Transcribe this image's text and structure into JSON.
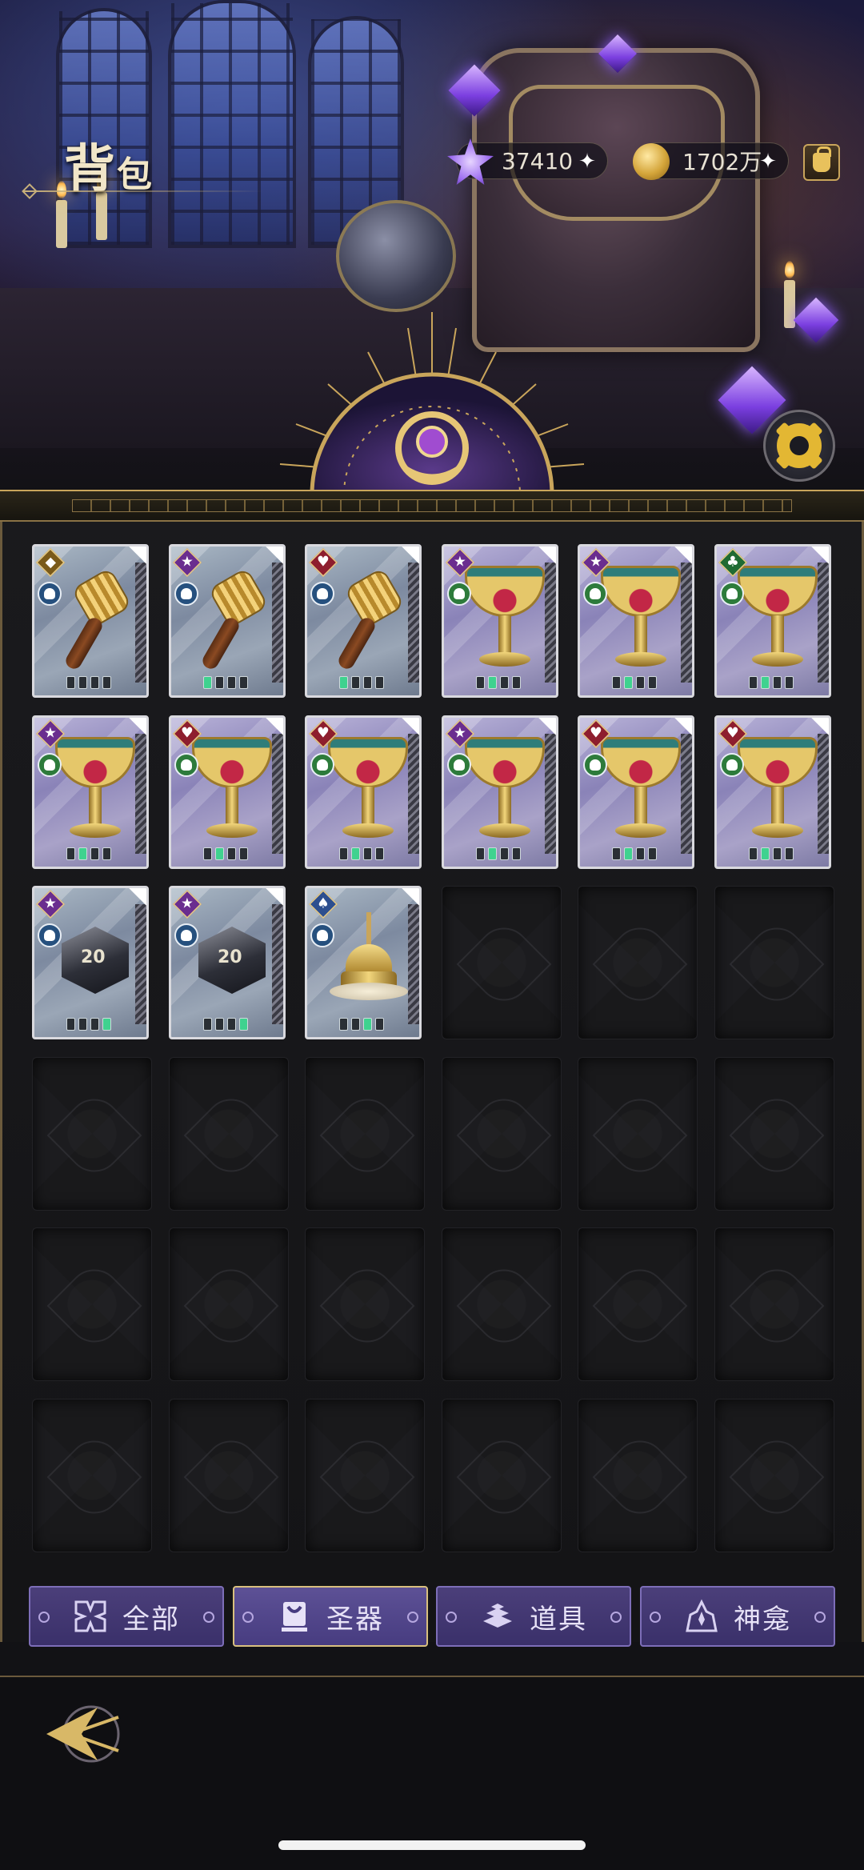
{
  "header": {
    "title_big": "背",
    "title_small": "包",
    "currencies": [
      {
        "id": "gem",
        "icon": "star-gem-icon",
        "value": "37410"
      },
      {
        "id": "coin",
        "icon": "gold-coin-icon",
        "value": "1702万"
      }
    ],
    "shop_icon": "shop-bag-icon",
    "settings_icon": "gear-icon"
  },
  "inventory": {
    "columns": 6,
    "visible_rows": 6,
    "filled_count": 15,
    "items": [
      {
        "art": "stamp",
        "rarity": "gold",
        "rarity_icon": "diamond-icon",
        "type": "blue",
        "pips": [
          0,
          0,
          0,
          0
        ]
      },
      {
        "art": "stamp",
        "rarity": "purple",
        "rarity_icon": "star-icon",
        "type": "blue",
        "pips": [
          1,
          0,
          0,
          0
        ]
      },
      {
        "art": "stamp",
        "rarity": "red",
        "rarity_icon": "heart-icon",
        "type": "blue",
        "pips": [
          1,
          0,
          0,
          0
        ]
      },
      {
        "art": "cup",
        "rarity": "purple",
        "rarity_icon": "star-icon",
        "type": "green",
        "pips": [
          0,
          1,
          0,
          0
        ]
      },
      {
        "art": "cup",
        "rarity": "purple",
        "rarity_icon": "star-icon",
        "type": "green",
        "pips": [
          0,
          1,
          0,
          0
        ]
      },
      {
        "art": "cup",
        "rarity": "green",
        "rarity_icon": "club-icon",
        "type": "green",
        "pips": [
          0,
          1,
          0,
          0
        ]
      },
      {
        "art": "cup",
        "rarity": "purple",
        "rarity_icon": "star-icon",
        "type": "green",
        "pips": [
          0,
          1,
          0,
          0
        ]
      },
      {
        "art": "cup",
        "rarity": "red",
        "rarity_icon": "heart-icon",
        "type": "green",
        "pips": [
          0,
          1,
          0,
          0
        ]
      },
      {
        "art": "cup",
        "rarity": "red",
        "rarity_icon": "heart-icon",
        "type": "green",
        "pips": [
          0,
          1,
          0,
          0
        ]
      },
      {
        "art": "cup",
        "rarity": "purple",
        "rarity_icon": "star-icon",
        "type": "green",
        "pips": [
          0,
          1,
          0,
          0
        ]
      },
      {
        "art": "cup",
        "rarity": "red",
        "rarity_icon": "heart-icon",
        "type": "green",
        "pips": [
          0,
          1,
          0,
          0
        ]
      },
      {
        "art": "cup",
        "rarity": "red",
        "rarity_icon": "heart-icon",
        "type": "green",
        "pips": [
          0,
          1,
          0,
          0
        ]
      },
      {
        "art": "dice",
        "rarity": "purple",
        "rarity_icon": "star-icon",
        "type": "blue",
        "pips": [
          0,
          0,
          0,
          1
        ]
      },
      {
        "art": "dice",
        "rarity": "purple",
        "rarity_icon": "star-icon",
        "type": "blue",
        "pips": [
          0,
          0,
          0,
          1
        ]
      },
      {
        "art": "lamp",
        "rarity": "blue",
        "rarity_icon": "spade-icon",
        "type": "blue",
        "pips": [
          0,
          0,
          1,
          0
        ]
      }
    ]
  },
  "tabs": [
    {
      "label": "全部",
      "icon": "all-icon",
      "active": false
    },
    {
      "label": "圣器",
      "icon": "relic-icon",
      "active": true
    },
    {
      "label": "道具",
      "icon": "items-icon",
      "active": false
    },
    {
      "label": "神龛",
      "icon": "shrine-icon",
      "active": false
    }
  ],
  "colors": {
    "accent_gold": "#c9a55b",
    "tab_purple": "#4b3f7a",
    "pip_active": "#3fd28f"
  }
}
